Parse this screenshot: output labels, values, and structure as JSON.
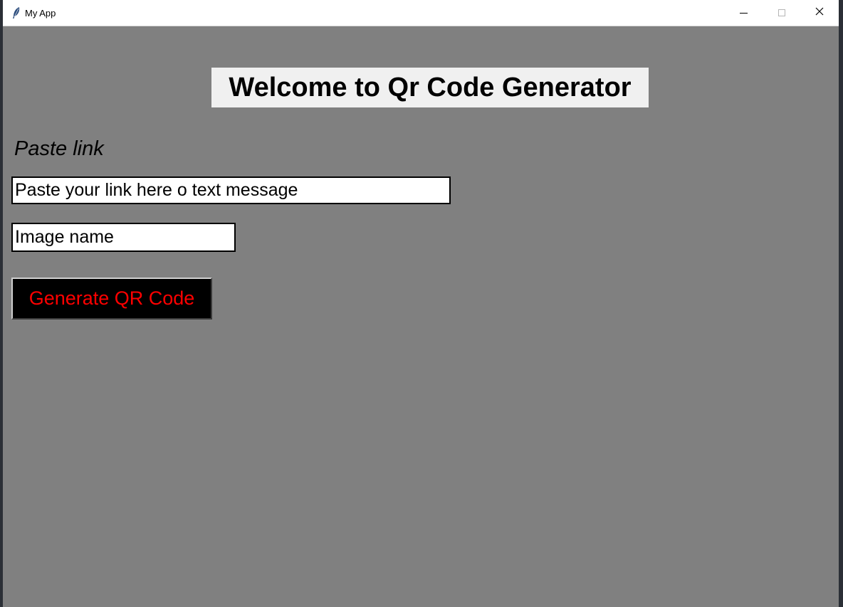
{
  "window": {
    "title": "My App",
    "icon": "feather-icon",
    "controls": [
      "minimize-icon",
      "maximize-icon",
      "close-icon"
    ]
  },
  "main": {
    "heading": "Welcome to Qr Code Generator",
    "paste_label": "Paste link",
    "link_input": {
      "value": "Paste your link here o text message"
    },
    "name_input": {
      "value": "Image name"
    },
    "generate_button": "Generate QR Code"
  },
  "colors": {
    "background": "#808080",
    "heading_bg": "#f0f0f0",
    "button_bg": "#000000",
    "button_text": "#ff0000"
  }
}
